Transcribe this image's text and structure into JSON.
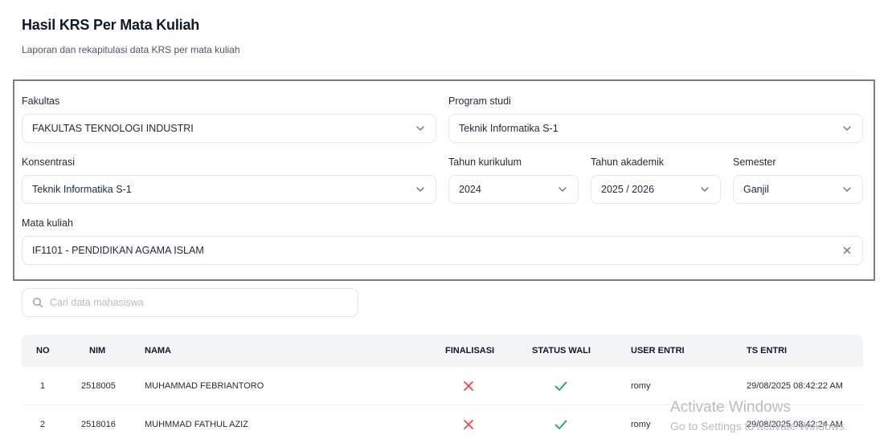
{
  "header": {
    "title": "Hasil KRS Per Mata Kuliah",
    "subtitle": "Laporan dan rekapitulasi data KRS per mata kuliah"
  },
  "filters": {
    "fakultas": {
      "label": "Fakultas",
      "value": "FAKULTAS TEKNOLOGI INDUSTRI"
    },
    "program_studi": {
      "label": "Program studi",
      "value": "Teknik Informatika S-1"
    },
    "konsentrasi": {
      "label": "Konsentrasi",
      "value": "Teknik Informatika S-1"
    },
    "tahun_kurikulum": {
      "label": "Tahun kurikulum",
      "value": "2024"
    },
    "tahun_akademik": {
      "label": "Tahun akademik",
      "value": "2025 / 2026"
    },
    "semester": {
      "label": "Semester",
      "value": "Ganjil"
    },
    "mata_kuliah": {
      "label": "Mata kuliah",
      "value": "IF1101 - PENDIDIKAN AGAMA ISLAM"
    }
  },
  "search": {
    "placeholder": "Cari data mahasiswa",
    "value": ""
  },
  "table": {
    "columns": [
      "NO",
      "NIM",
      "NAMA",
      "FINALISASI",
      "STATUS WALI",
      "USER ENTRI",
      "TS ENTRI"
    ],
    "rows": [
      {
        "no": "1",
        "nim": "2518005",
        "nama": "MUHAMMAD FEBRIANTORO",
        "finalisasi": "no",
        "status_wali": "yes",
        "user_entri": "romy",
        "ts_entri": "29/08/2025 08:42:22 AM"
      },
      {
        "no": "2",
        "nim": "2518016",
        "nama": "MUHMMAD FATHUL AZIZ",
        "finalisasi": "no",
        "status_wali": "yes",
        "user_entri": "romy",
        "ts_entri": "29/08/2025 08:42:24 AM"
      }
    ]
  },
  "colors": {
    "cross": "#e5484d",
    "check": "#22a559",
    "focus_border": "#7d7d7d"
  },
  "watermark": {
    "line1": "Activate Windows",
    "line2": "Go to Settings to activate Windows."
  }
}
